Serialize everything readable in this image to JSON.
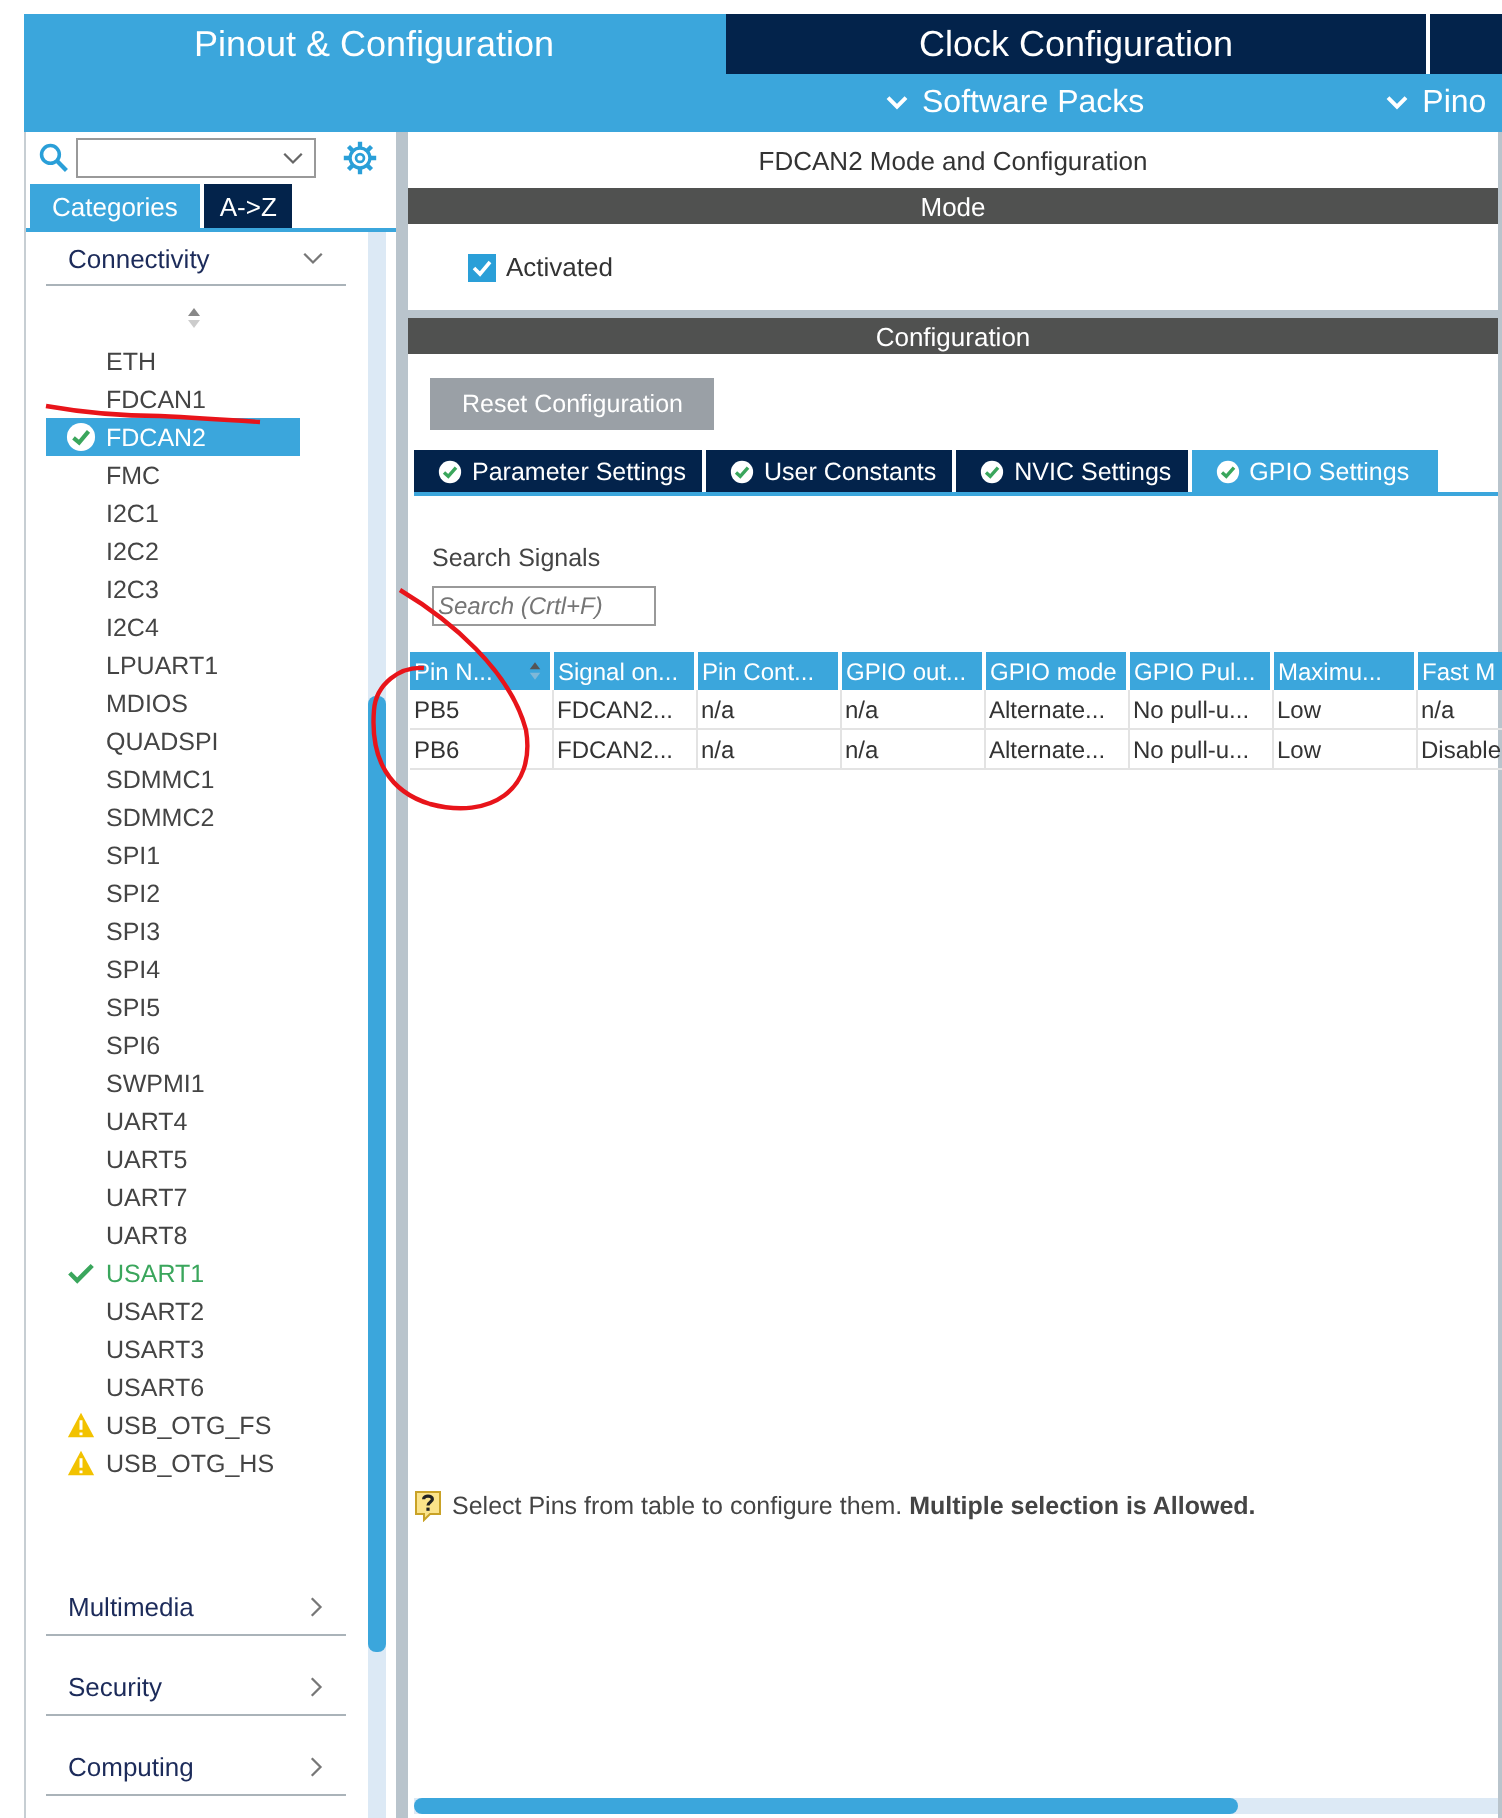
{
  "top_tabs": [
    {
      "label": "Pinout & Configuration",
      "selected": true
    },
    {
      "label": "Clock Configuration",
      "selected": false
    }
  ],
  "menus": [
    {
      "label": "Software Packs"
    },
    {
      "label": "Pino"
    }
  ],
  "view_tabs": [
    {
      "label": "Categories",
      "selected": true
    },
    {
      "label": "A->Z",
      "selected": false
    }
  ],
  "categories": [
    {
      "label": "Connectivity",
      "expanded": true,
      "items": [
        {
          "label": "ETH",
          "selected": false,
          "kind": "plain"
        },
        {
          "label": "FDCAN1",
          "selected": false,
          "kind": "plain"
        },
        {
          "label": "FDCAN2",
          "selected": true,
          "kind": "configured"
        },
        {
          "label": "FMC",
          "selected": false,
          "kind": "plain"
        },
        {
          "label": "I2C1",
          "selected": false,
          "kind": "plain"
        },
        {
          "label": "I2C2",
          "selected": false,
          "kind": "plain"
        },
        {
          "label": "I2C3",
          "selected": false,
          "kind": "plain"
        },
        {
          "label": "I2C4",
          "selected": false,
          "kind": "plain"
        },
        {
          "label": "LPUART1",
          "selected": false,
          "kind": "plain"
        },
        {
          "label": "MDIOS",
          "selected": false,
          "kind": "plain"
        },
        {
          "label": "QUADSPI",
          "selected": false,
          "kind": "plain"
        },
        {
          "label": "SDMMC1",
          "selected": false,
          "kind": "plain"
        },
        {
          "label": "SDMMC2",
          "selected": false,
          "kind": "plain"
        },
        {
          "label": "SPI1",
          "selected": false,
          "kind": "plain"
        },
        {
          "label": "SPI2",
          "selected": false,
          "kind": "plain"
        },
        {
          "label": "SPI3",
          "selected": false,
          "kind": "plain"
        },
        {
          "label": "SPI4",
          "selected": false,
          "kind": "plain"
        },
        {
          "label": "SPI5",
          "selected": false,
          "kind": "plain"
        },
        {
          "label": "SPI6",
          "selected": false,
          "kind": "plain"
        },
        {
          "label": "SWPMI1",
          "selected": false,
          "kind": "plain"
        },
        {
          "label": "UART4",
          "selected": false,
          "kind": "plain"
        },
        {
          "label": "UART5",
          "selected": false,
          "kind": "plain"
        },
        {
          "label": "UART7",
          "selected": false,
          "kind": "plain"
        },
        {
          "label": "UART8",
          "selected": false,
          "kind": "plain"
        },
        {
          "label": "USART1",
          "selected": false,
          "kind": "configured"
        },
        {
          "label": "USART2",
          "selected": false,
          "kind": "plain"
        },
        {
          "label": "USART3",
          "selected": false,
          "kind": "plain"
        },
        {
          "label": "USART6",
          "selected": false,
          "kind": "plain"
        },
        {
          "label": "USB_OTG_FS",
          "selected": false,
          "kind": "warning"
        },
        {
          "label": "USB_OTG_HS",
          "selected": false,
          "kind": "warning"
        }
      ]
    },
    {
      "label": "Multimedia",
      "expanded": false
    },
    {
      "label": "Security",
      "expanded": false
    },
    {
      "label": "Computing",
      "expanded": false
    }
  ],
  "panel_title": "FDCAN2 Mode and Configuration",
  "mode": {
    "header": "Mode",
    "activated": {
      "label": "Activated",
      "checked": true
    }
  },
  "configuration": {
    "header": "Configuration",
    "reset_button": "Reset Configuration",
    "tabs": [
      {
        "label": "Parameter Settings",
        "selected": false
      },
      {
        "label": "User Constants",
        "selected": false
      },
      {
        "label": "NVIC Settings",
        "selected": false
      },
      {
        "label": "GPIO Settings",
        "selected": true
      }
    ],
    "search_label": "Search Signals",
    "search_placeholder": "Search (Crtl+F)",
    "table": {
      "columns": [
        {
          "label": "Pin N...",
          "sorted": true
        },
        {
          "label": "Signal on...",
          "sorted": false
        },
        {
          "label": "Pin Cont...",
          "sorted": false
        },
        {
          "label": "GPIO out...",
          "sorted": false
        },
        {
          "label": "GPIO mode",
          "sorted": false
        },
        {
          "label": "GPIO Pul...",
          "sorted": false
        },
        {
          "label": "Maximu...",
          "sorted": false
        },
        {
          "label": "Fast M",
          "sorted": false
        }
      ],
      "rows": [
        [
          "PB5",
          "FDCAN2...",
          "n/a",
          "n/a",
          "Alternate...",
          "No pull-u...",
          "Low",
          "n/a"
        ],
        [
          "PB6",
          "FDCAN2...",
          "n/a",
          "n/a",
          "Alternate...",
          "No pull-u...",
          "Low",
          "Disable"
        ]
      ]
    },
    "hint": "Select Pins from table to configure them. **Multiple selection is Allowed.**"
  }
}
